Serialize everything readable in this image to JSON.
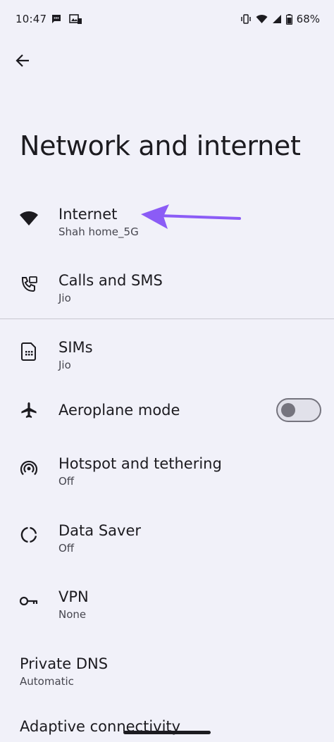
{
  "status_bar": {
    "time": "10:47",
    "battery": "68%",
    "left_icons": [
      "chat-bubble-icon",
      "photos-icon"
    ],
    "right_icons": [
      "vibrate-icon",
      "wifi-icon",
      "signal-icon",
      "battery-icon"
    ]
  },
  "header": {
    "back_icon": "arrow-back-icon",
    "title": "Network and internet"
  },
  "settings": {
    "internet": {
      "title": "Internet",
      "subtitle": "Shah home_5G",
      "icon": "wifi-icon"
    },
    "calls_sms": {
      "title": "Calls and SMS",
      "subtitle": "Jio",
      "icon": "calls-sms-icon"
    },
    "sims": {
      "title": "SIMs",
      "subtitle": "Jio",
      "icon": "sim-card-icon"
    },
    "aeroplane": {
      "title": "Aeroplane mode",
      "icon": "airplane-icon",
      "enabled": false
    },
    "hotspot": {
      "title": "Hotspot and tethering",
      "subtitle": "Off",
      "icon": "hotspot-icon"
    },
    "data_saver": {
      "title": "Data Saver",
      "subtitle": "Off",
      "icon": "data-saver-icon"
    },
    "vpn": {
      "title": "VPN",
      "subtitle": "None",
      "icon": "vpn-key-icon"
    },
    "private_dns": {
      "title": "Private DNS",
      "subtitle": "Automatic"
    },
    "adaptive": {
      "title": "Adaptive connectivity"
    }
  },
  "colors": {
    "background": "#f1f1f9",
    "text_primary": "#1c1b20",
    "text_secondary": "#46464f",
    "annotation_arrow": "#8b5cf6",
    "toggle_off": "#75747e"
  }
}
